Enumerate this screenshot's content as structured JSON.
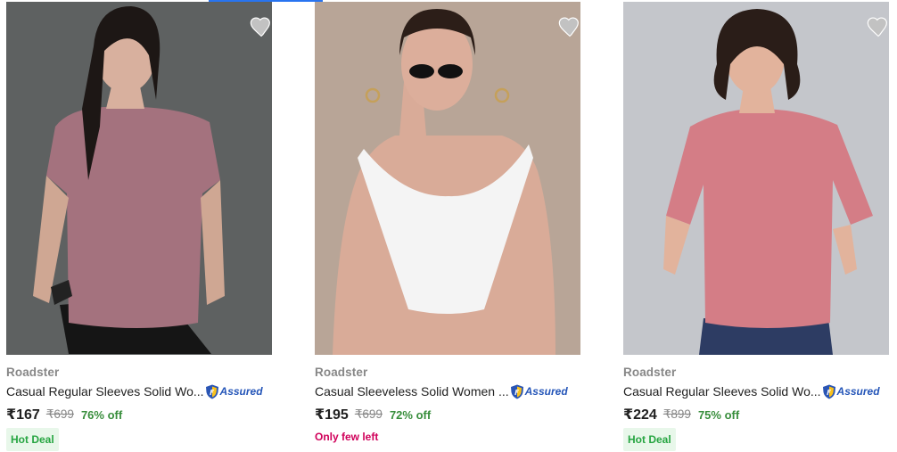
{
  "products": [
    {
      "brand": "Roadster",
      "title": "Casual Regular Sleeves Solid Wo...",
      "assured_label": "Assured",
      "price": "₹167",
      "mrp": "₹699",
      "discount": "76% off",
      "tag": "Hot Deal",
      "image": "model-mauve-tshirt",
      "wishlist_icon": "heart-icon"
    },
    {
      "brand": "Roadster",
      "title": "Casual Sleeveless Solid Women ...",
      "assured_label": "Assured",
      "price": "₹195",
      "mrp": "₹699",
      "discount": "72% off",
      "stock_note": "Only few left",
      "image": "model-white-top",
      "wishlist_icon": "heart-icon"
    },
    {
      "brand": "Roadster",
      "title": "Casual Regular Sleeves Solid Wo...",
      "assured_label": "Assured",
      "price": "₹224",
      "mrp": "₹899",
      "discount": "75% off",
      "tag": "Hot Deal",
      "image": "model-pink-tshirt",
      "wishlist_icon": "heart-icon"
    }
  ],
  "colors": {
    "accent": "#2874f0",
    "discount": "#388e3c",
    "deal_bg": "#e8f7ea",
    "low_stock": "#d0005a"
  }
}
